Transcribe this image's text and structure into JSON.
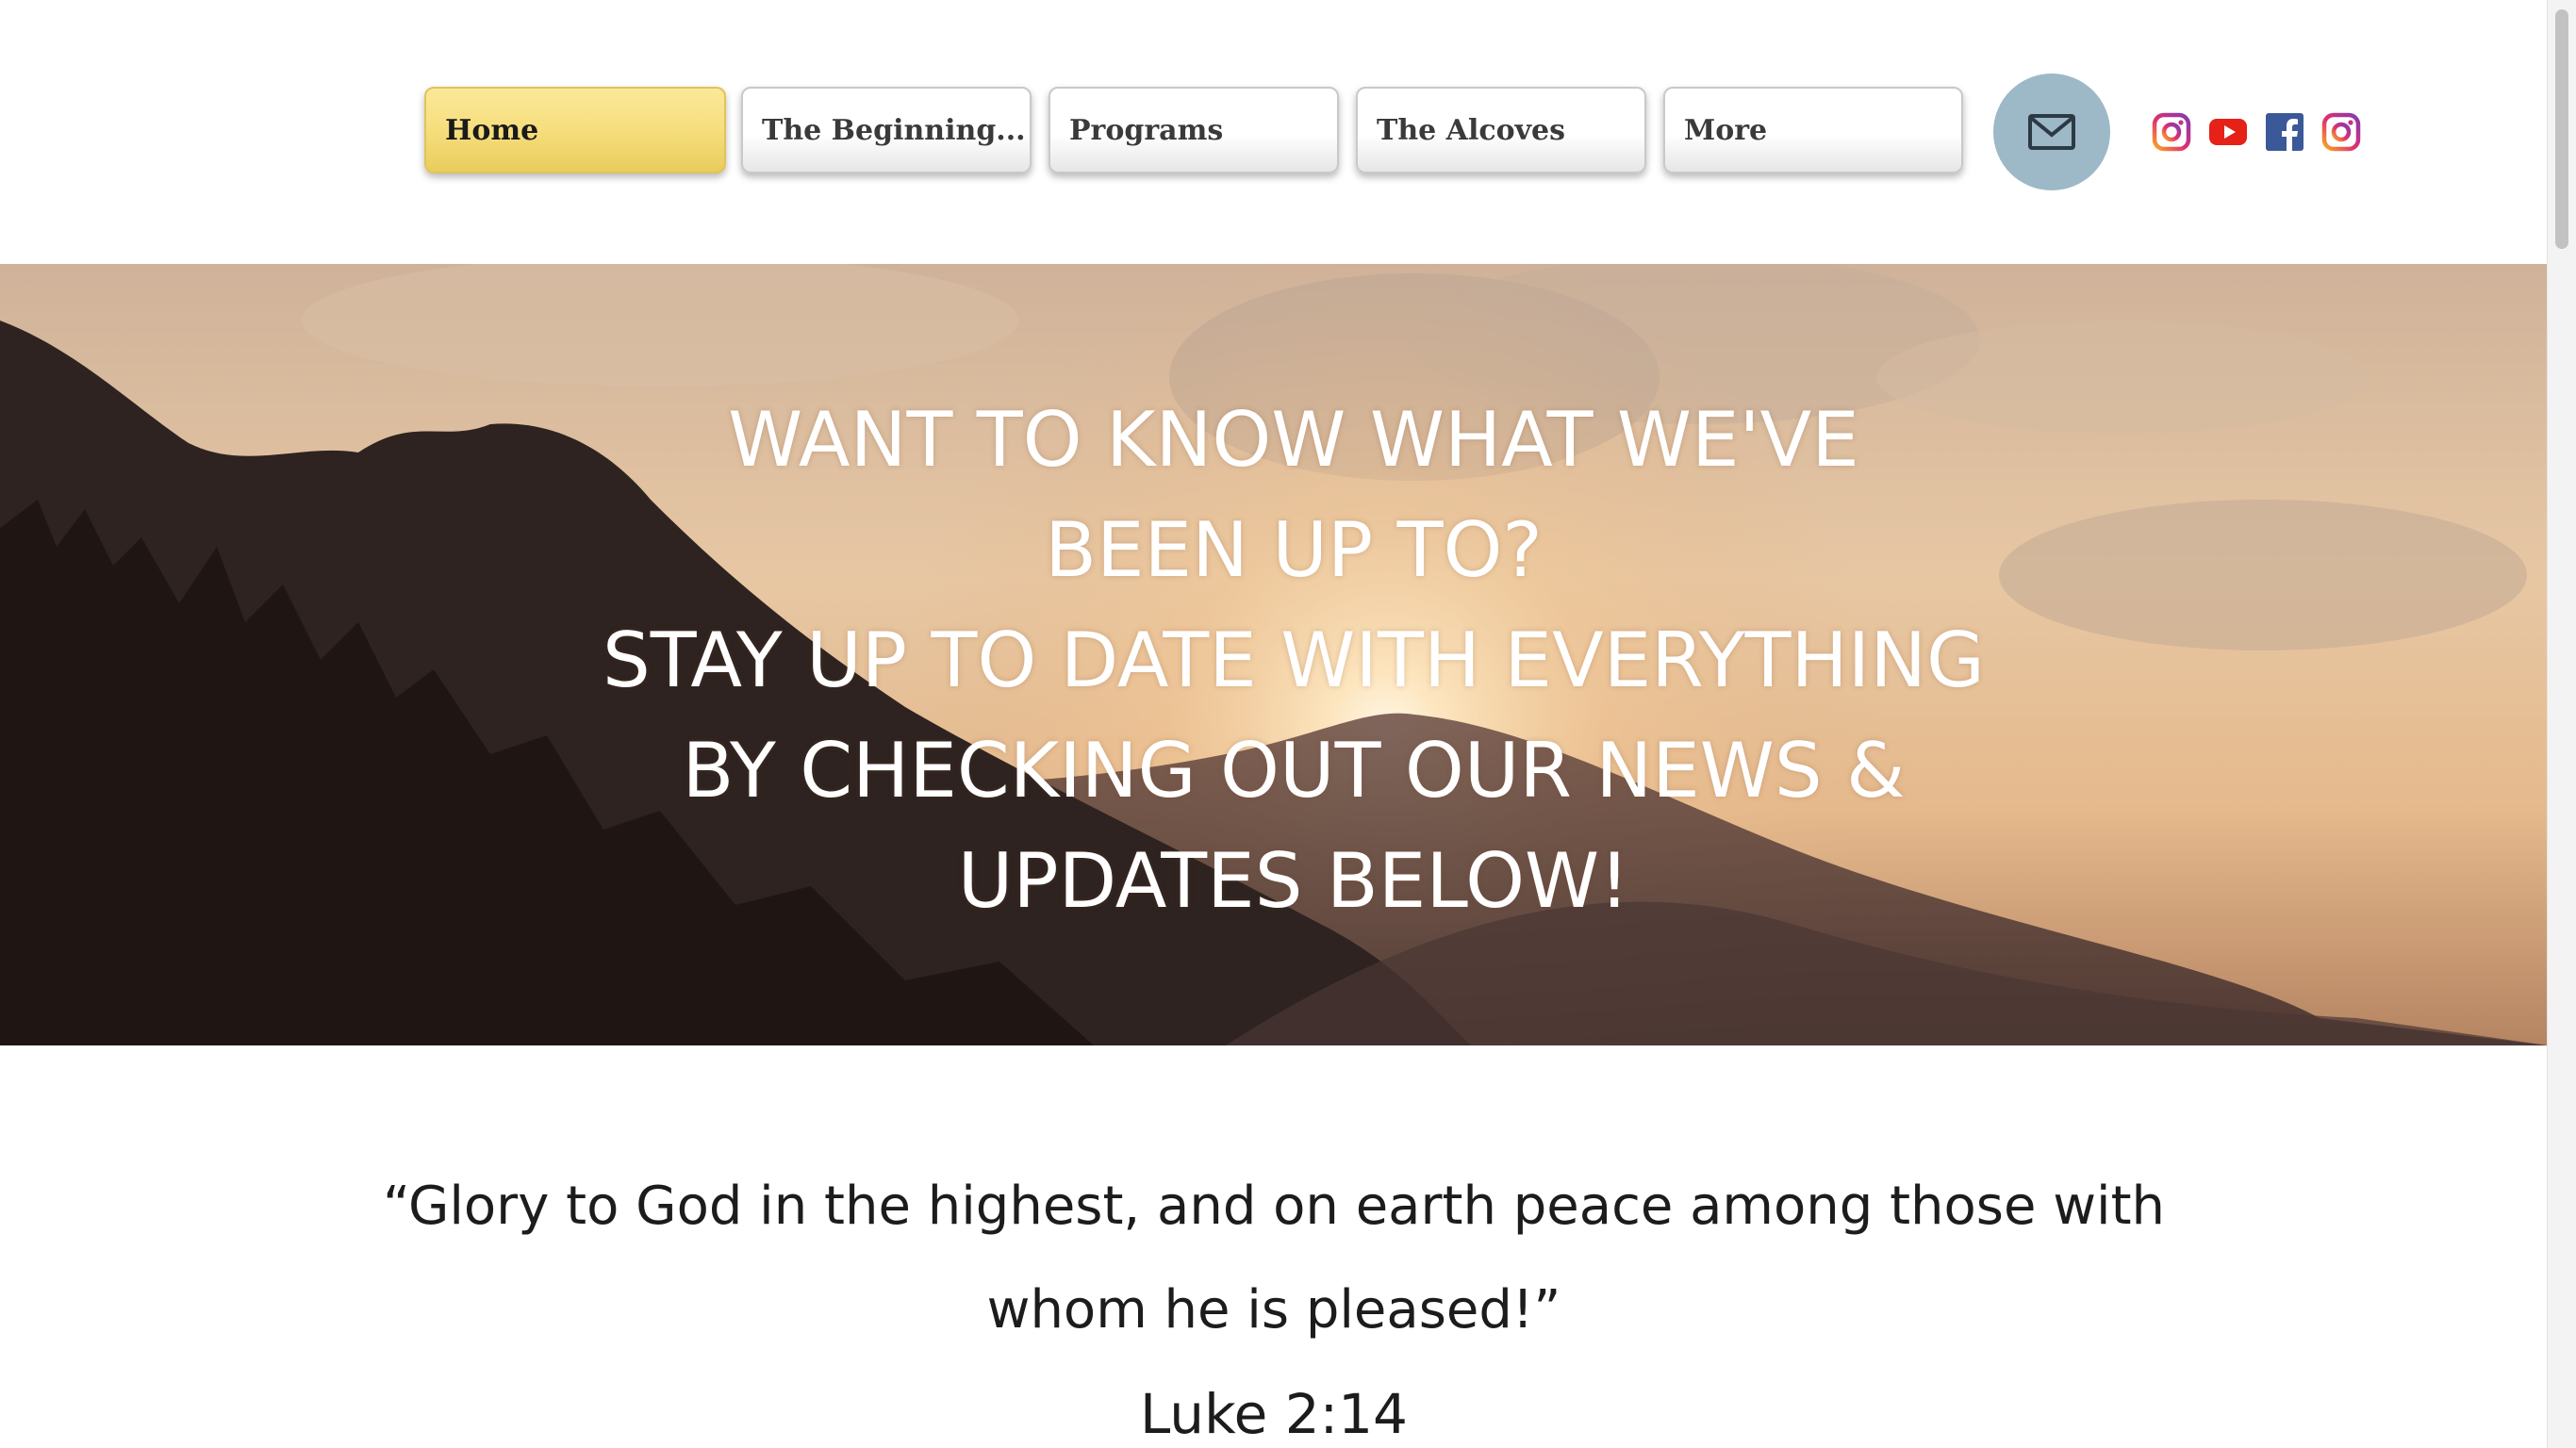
{
  "nav": {
    "items": [
      {
        "label": "Home",
        "active": true
      },
      {
        "label": "The Beginning...",
        "active": false
      },
      {
        "label": "Programs",
        "active": false
      },
      {
        "label": "The Alcoves",
        "active": false
      },
      {
        "label": "More",
        "active": false
      }
    ],
    "mail_icon": "mail-icon",
    "social": [
      "instagram-icon",
      "youtube-icon",
      "facebook-icon",
      "instagram-icon"
    ]
  },
  "hero": {
    "lines": [
      "WANT TO KNOW WHAT WE'VE",
      "BEEN UP TO?",
      "STAY UP TO DATE WITH EVERYTHING",
      "BY CHECKING OUT OUR NEWS &",
      "UPDATES BELOW!"
    ]
  },
  "quote": {
    "line1": "“Glory to God in the highest, and on earth peace among those with",
    "line2": "whom he is pleased!”",
    "reference": "Luke 2:14"
  },
  "colors": {
    "accent_gold": "#f6de7d",
    "mail_bg": "#9db8c6",
    "youtube_red": "#e62117",
    "facebook_blue": "#3b5998"
  }
}
